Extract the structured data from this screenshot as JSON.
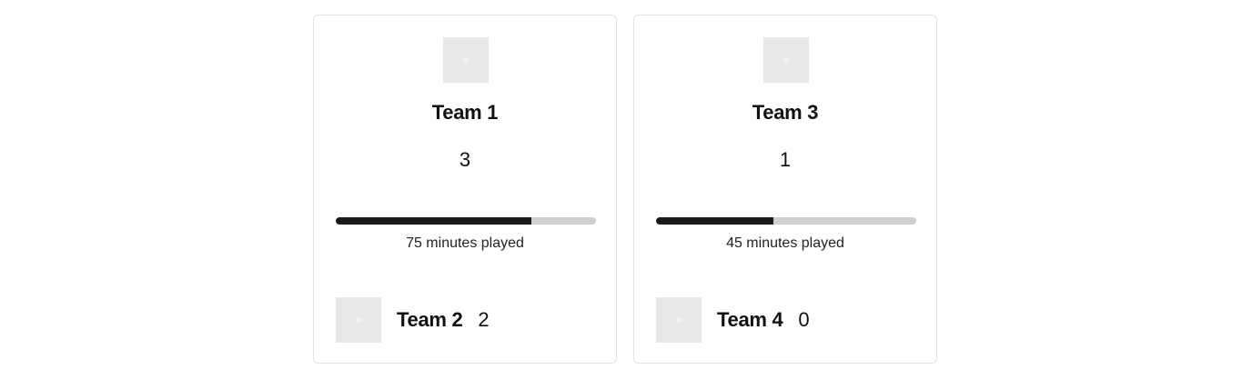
{
  "matches": [
    {
      "home_team": "Team 1",
      "home_score": "3",
      "progress_fraction": 0.75,
      "minutes_text": "75 minutes played",
      "away_team": "Team 2",
      "away_score": "2"
    },
    {
      "home_team": "Team 3",
      "home_score": "1",
      "progress_fraction": 0.45,
      "minutes_text": "45 minutes played",
      "away_team": "Team 4",
      "away_score": "0"
    }
  ],
  "colors": {
    "progress_fill": "#1a1a1d",
    "progress_track": "#cfcfcf",
    "card_border": "#e3e3e3",
    "logo_placeholder": "#e8e8e8"
  },
  "icons": {
    "team_logo": "team-logo-placeholder-icon"
  }
}
